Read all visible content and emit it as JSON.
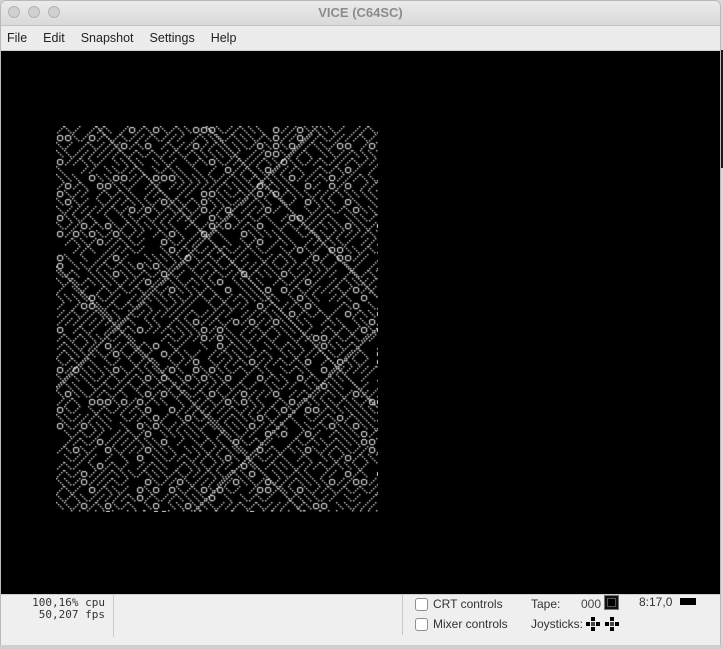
{
  "window": {
    "title": "VICE (C64SC)"
  },
  "menu": [
    "File",
    "Edit",
    "Snapshot",
    "Settings",
    "Help"
  ],
  "status": {
    "cpu": "100,16% cpu",
    "fps": "50,207 fps",
    "crt_label": "CRT controls",
    "mixer_label": "Mixer controls",
    "tape_label": "Tape:",
    "tape_counter": "000",
    "drive_status": "8:17,0",
    "joysticks_label": "Joysticks:"
  },
  "colors": {
    "screen_bg": "#000000",
    "pattern_fg": "#d8d8d8"
  }
}
